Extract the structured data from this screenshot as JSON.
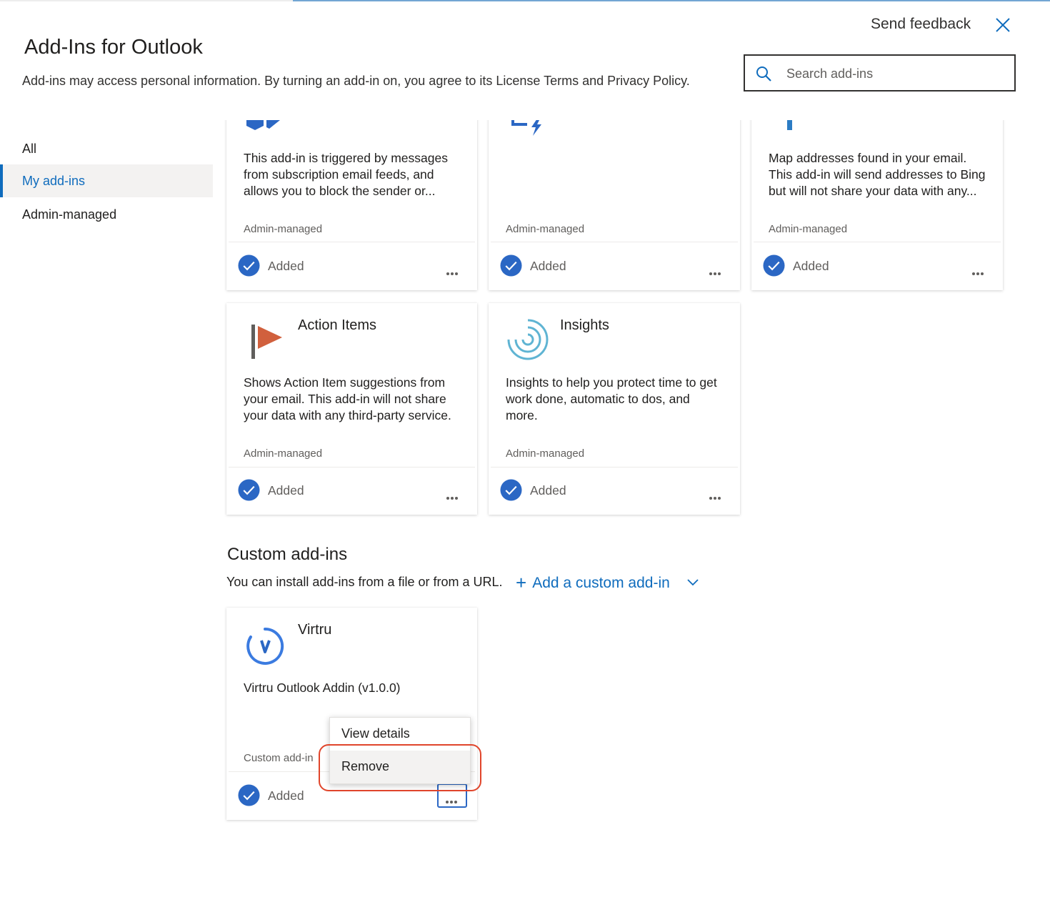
{
  "dialog": {
    "title": "Add-Ins for Outlook",
    "subtitle": "Add-ins may access personal information. By turning an add-in on, you agree to its License Terms and Privacy Policy.",
    "send_feedback": "Send feedback",
    "search_placeholder": "Search add-ins"
  },
  "sidebar": {
    "items": [
      {
        "label": "All",
        "selected": false
      },
      {
        "label": "My add-ins",
        "selected": true
      },
      {
        "label": "Admin-managed",
        "selected": false
      }
    ]
  },
  "cards": [
    {
      "name": "",
      "description": "This add-in is triggered by messages from subscription email feeds, and allows you to block the sender or...",
      "badge": "Admin-managed",
      "status": "Added",
      "icon": "report-message-icon"
    },
    {
      "name": "",
      "description": "",
      "badge": "Admin-managed",
      "status": "Added",
      "icon": "power-automate-icon"
    },
    {
      "name": "",
      "description": "Map addresses found in your email. This add-in will send addresses to Bing but will not share your data with any...",
      "badge": "Admin-managed",
      "status": "Added",
      "icon": "bing-maps-icon"
    },
    {
      "name": "Action Items",
      "description": "Shows Action Item suggestions from your email. This add-in will not share your data with any third-party service.",
      "badge": "Admin-managed",
      "status": "Added",
      "icon": "flag-icon"
    },
    {
      "name": "Insights",
      "description": "Insights to help you protect time to get work done, automatic to dos, and more.",
      "badge": "Admin-managed",
      "status": "Added",
      "icon": "insights-icon"
    }
  ],
  "custom": {
    "title": "Custom add-ins",
    "description": "You can install add-ins from a file or from a URL.",
    "add_link": "Add a custom add-in",
    "card": {
      "name": "Virtru",
      "description": "Virtru Outlook Addin (v1.0.0)",
      "badge": "Custom add-in",
      "status": "Added",
      "icon": "virtru-icon"
    }
  },
  "context_menu": {
    "items": [
      "View details",
      "Remove"
    ],
    "highlighted": "Remove"
  },
  "colors": {
    "accent": "#0f6cbd",
    "check": "#2b67c4",
    "flag": "#d1603d",
    "highlight": "#e0452b"
  }
}
